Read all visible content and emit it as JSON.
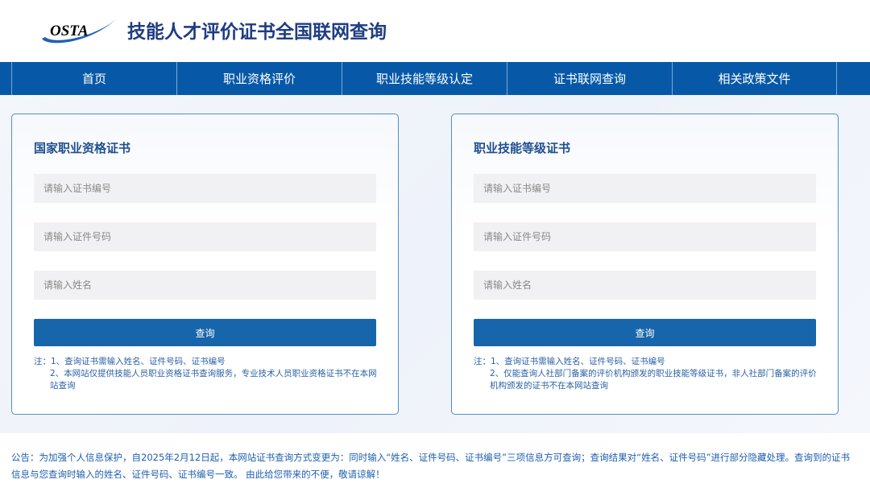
{
  "header": {
    "logo_text": "OSTA",
    "title": "技能人才评价证书全国联网查询"
  },
  "nav": {
    "items": [
      "首页",
      "职业资格评价",
      "职业技能等级认定",
      "证书联网查询",
      "相关政策文件"
    ]
  },
  "cards": [
    {
      "title": "国家职业资格证书",
      "cert_no_placeholder": "请输入证书编号",
      "id_no_placeholder": "请输入证件号码",
      "name_placeholder": "请输入姓名",
      "button": "查询",
      "note1": "注：1、查询证书需输入姓名、证件号码、证书编号",
      "note2": "2、本网站仅提供技能人员职业资格证书查询服务，专业技术人员职业资格证书不在本网站查询"
    },
    {
      "title": "职业技能等级证书",
      "cert_no_placeholder": "请输入证书编号",
      "id_no_placeholder": "请输入证件号码",
      "name_placeholder": "请输入姓名",
      "button": "查询",
      "note1": "注：1、查询证书需输入姓名、证件号码、证书编号",
      "note2": "2、仅能查询人社部门备案的评价机构颁发的职业技能等级证书，非人社部门备案的评价机构颁发的证书不在本网站查询"
    }
  ],
  "announcement": "公告：为加强个人信息保护，自2025年2月12日起，本网站证书查询方式变更为：同时输入“姓名、证件号码、证书编号”三项信息方可查询；查询结果对“姓名、证件号码”进行部分隐藏处理。查询到的证书信息与您查询时输入的姓名、证件号码、证书编号一致。 由此给您带来的不便，敬请谅解！"
}
